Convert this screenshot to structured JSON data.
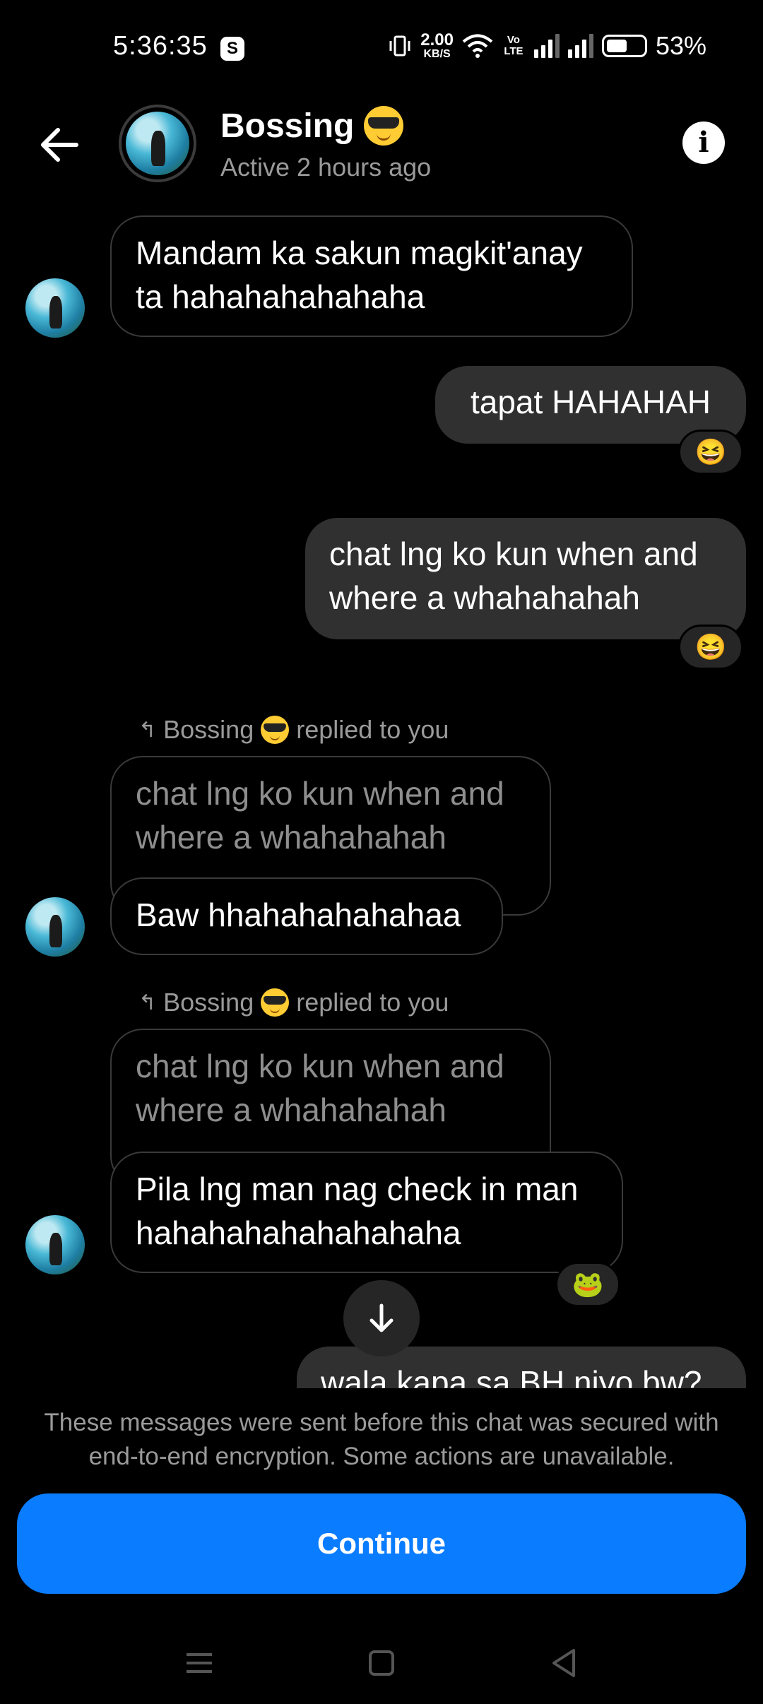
{
  "status_bar": {
    "time": "5:36:35",
    "app_badge": "S",
    "net_speed": "2.00",
    "net_unit": "KB/S",
    "volte": "Vo LTE",
    "battery": "53%"
  },
  "header": {
    "name": "Bossing",
    "status": "Active 2 hours ago"
  },
  "messages": [
    {
      "text": "Mandam ka sakun magkit'anay ta hahahahahahaha"
    },
    {
      "text": "tapat HAHAHAH",
      "reaction": "😆"
    },
    {
      "text": "chat lng ko kun when and where a whahahahah",
      "reaction": "😆"
    },
    {
      "reply_label": "Bossing",
      "reply_suffix": "replied to you",
      "quoted": "chat lng ko kun when and where a whahahahah",
      "text": "Baw hhahahahahahaa"
    },
    {
      "reply_label": "Bossing",
      "reply_suffix": "replied to you",
      "quoted": "chat lng ko kun when and where a whahahahah",
      "text": "Pila lng man nag check in man hahahahahahahahaha",
      "reaction": "🐸"
    },
    {
      "text": "wala kapa sa BH niyo bw?"
    }
  ],
  "footer": {
    "notice": "These messages were sent before this chat was secured with end-to-end encryption. Some actions are unavailable.",
    "continue_label": "Continue"
  },
  "colors": {
    "accent": "#0a7cff",
    "background": "#000000",
    "outgoing_bubble": "#303030"
  }
}
